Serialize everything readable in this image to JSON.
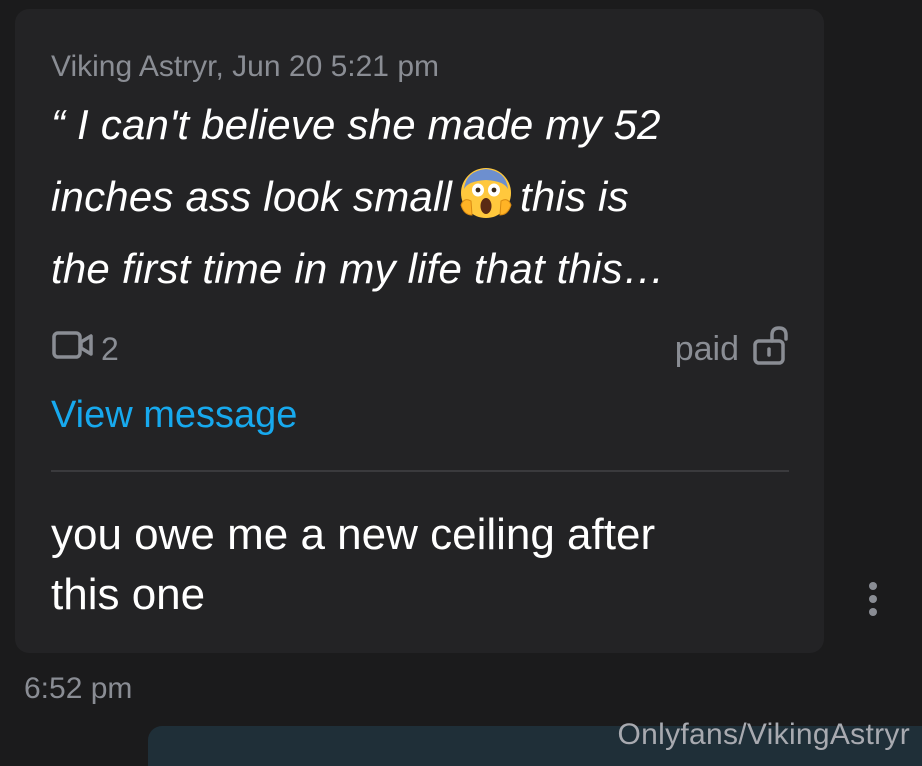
{
  "message": {
    "quote": {
      "author_line": "Viking Astryr, Jun 20 5:21 pm",
      "line1": "“ I can't believe she made my 52",
      "line2_before": "inches ass look small",
      "emoji": "face-screaming-in-fear-emoji",
      "line2_after": "this is",
      "line3": "the first time in my life that this…"
    },
    "media_icon": "video-camera-icon",
    "media_count": "2",
    "paid_label": "paid",
    "paid_icon": "unlocked-padlock-icon",
    "view_link": "View message",
    "reply_line1": "you owe me a new ceiling after",
    "reply_line2": "this one",
    "more_icon": "vertical-ellipsis-icon",
    "timestamp": "6:52 pm"
  },
  "watermark": "Onlyfans/VikingAstryr",
  "colors": {
    "background": "#1b1b1c",
    "bubble": "#232325",
    "link": "#17a9ee",
    "muted_text": "#8a8d94",
    "text": "#ffffff",
    "outgoing_bubble": "#1f2f38"
  }
}
